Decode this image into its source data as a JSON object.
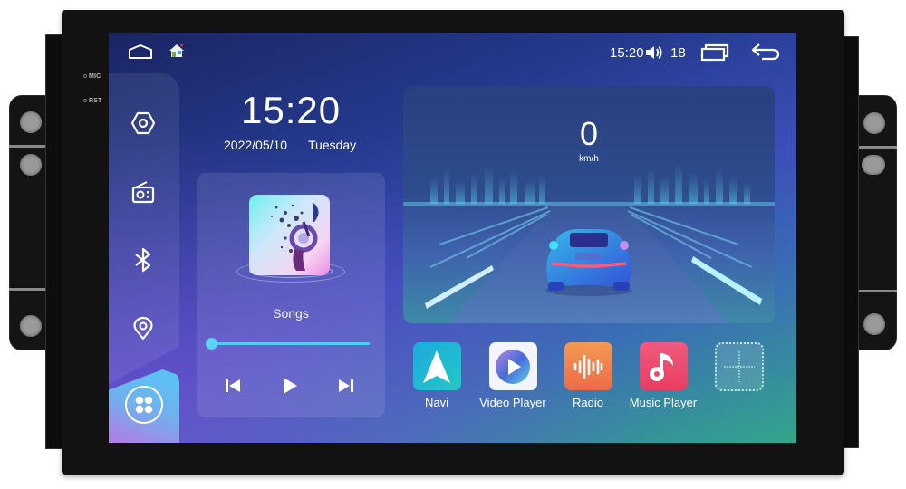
{
  "device": {
    "bezel_labels": [
      "MIC",
      "RST"
    ]
  },
  "status_bar": {
    "icons": [
      "home-outline-icon",
      "launcher-house-icon",
      "volume-icon",
      "recents-icon",
      "back-arrow-icon"
    ],
    "time": "15:20",
    "volume_level": "18"
  },
  "sidebar": {
    "items": [
      {
        "id": "settings",
        "icon": "hexagon-settings-icon"
      },
      {
        "id": "radio",
        "icon": "radio-icon"
      },
      {
        "id": "bluetooth",
        "icon": "bluetooth-icon"
      },
      {
        "id": "navigation",
        "icon": "location-pin-icon"
      },
      {
        "id": "apps",
        "icon": "apps-grid-icon"
      }
    ]
  },
  "clock": {
    "time": "15:20",
    "date": "2022/05/10",
    "weekday": "Tuesday"
  },
  "music": {
    "title": "Songs",
    "progress_percent": 0,
    "controls": [
      "previous",
      "play",
      "next"
    ],
    "accent_color": "#4fd0ee"
  },
  "speedometer": {
    "value": "0",
    "unit": "km/h"
  },
  "dock": {
    "apps": [
      {
        "label": "Navi",
        "icon": "navigation-arrow-icon",
        "color": "#1fb6d8"
      },
      {
        "label": "Video Player",
        "icon": "play-circle-icon",
        "color": "#f3f5fa"
      },
      {
        "label": "Radio",
        "icon": "sound-wave-icon",
        "color": "#f07a4a"
      },
      {
        "label": "Music Player",
        "icon": "music-note-icon",
        "color": "#ee4a6e"
      }
    ],
    "add_slot": "add-app-icon"
  }
}
